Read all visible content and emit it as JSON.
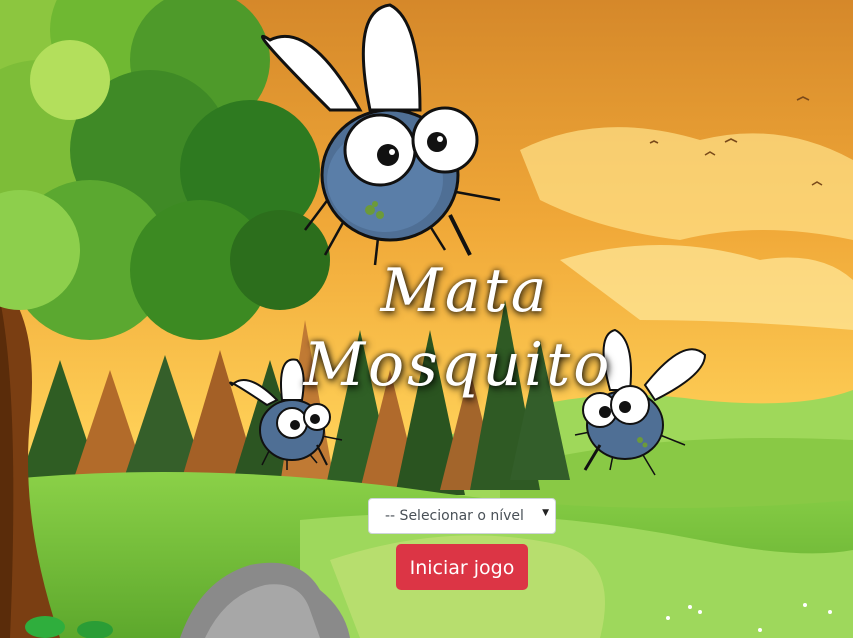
{
  "game": {
    "title_line1": "Mata",
    "title_line2": "Mosquito"
  },
  "controls": {
    "level_select": {
      "selected": "-- Selecionar o nível",
      "caret": "▼"
    },
    "start_button_label": "Iniciar jogo"
  },
  "colors": {
    "button": "#dc3545",
    "sky_top": "#e8a030",
    "sky_bottom": "#ffd75a",
    "grass": "#7cc43f",
    "mosquito_body": "#4f6f95"
  }
}
